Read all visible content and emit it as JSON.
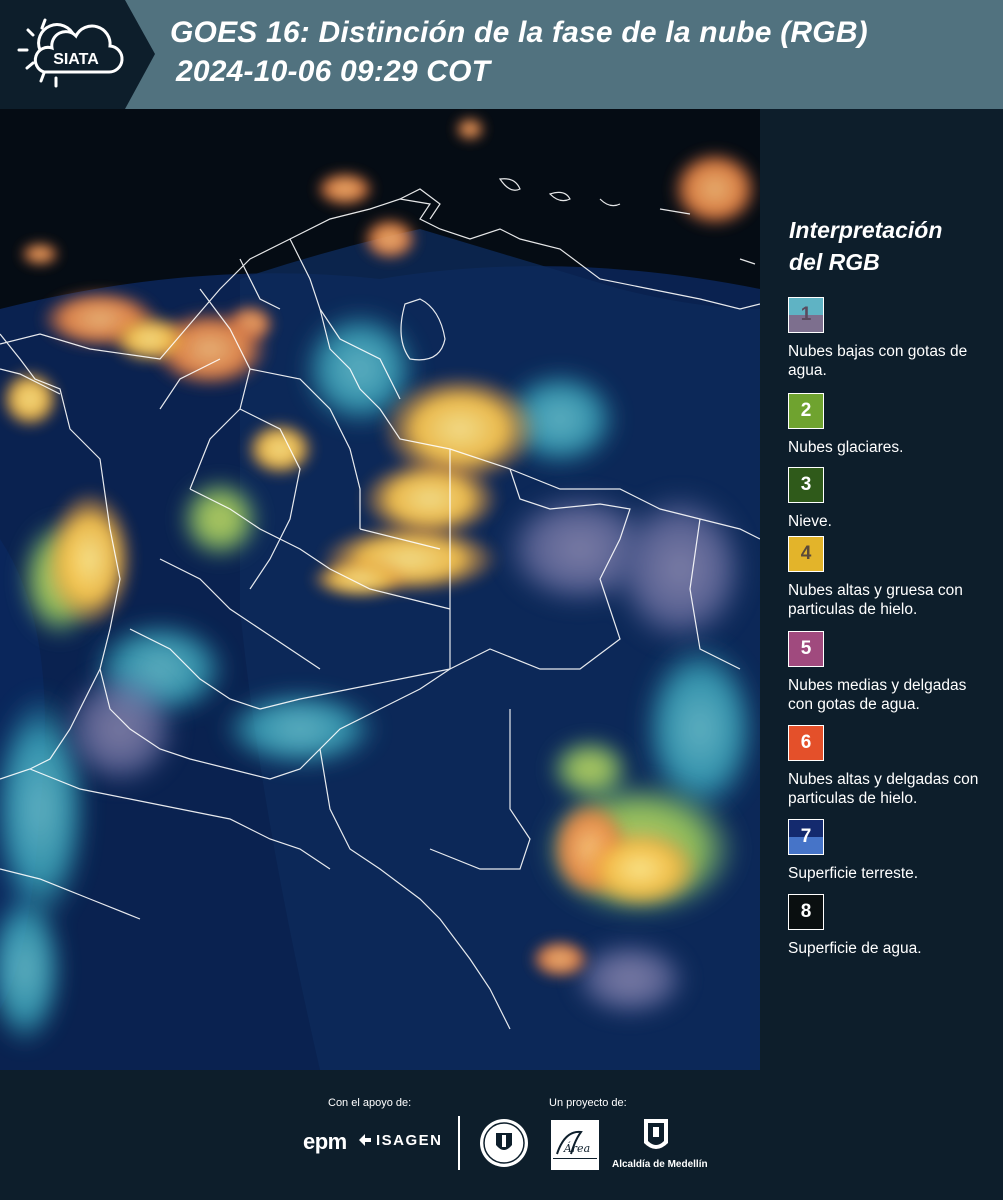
{
  "header": {
    "logo_text": "SIATA",
    "title_line1": "GOES 16: Distinción de la fase de la nube (RGB)",
    "title_line2": "2024-10-06 09:29 COT"
  },
  "map": {
    "icon": "satellite-rgb-image"
  },
  "legend": {
    "title_line1": "Interpretación",
    "title_line2": "del RGB",
    "items": [
      {
        "number": "1",
        "description": "Nubes bajas con gotas de agua.",
        "color_top": "#5fb3c4",
        "color_bottom": "#7d6f8e"
      },
      {
        "number": "2",
        "description": "Nubes glaciares.",
        "color_top": "#6fa32f",
        "color_bottom": "#6fa32f"
      },
      {
        "number": "3",
        "description": "Nieve.",
        "color_top": "#2f5a1a",
        "color_bottom": "#2f5a1a"
      },
      {
        "number": "4",
        "description": "Nubes altas y gruesa con particulas de hielo.",
        "color_top": "#e3b42a",
        "color_bottom": "#e3b42a"
      },
      {
        "number": "5",
        "description": "Nubes medias y delgadas con gotas de agua.",
        "color_top": "#a04a7e",
        "color_bottom": "#a04a7e"
      },
      {
        "number": "6",
        "description": "Nubes altas y delgadas con particulas de hielo.",
        "color_top": "#e4502a",
        "color_bottom": "#e4502a"
      },
      {
        "number": "7",
        "description": "Superficie terreste.",
        "color_top": "#142a6e",
        "color_bottom": "#4674c8"
      },
      {
        "number": "8",
        "description": "Superficie de agua.",
        "color_top": "#0a0f10",
        "color_bottom": "#0a0f10"
      }
    ]
  },
  "footer": {
    "support_label": "Con el apoyo de:",
    "project_label": "Un proyecto de:",
    "epm_logo": "epm",
    "isagen_logo": "ISAGEN",
    "amva_logo": "Área METROPOLITANA Valle de Aburrá",
    "alcaldia_label": "Alcaldía de Medellín"
  },
  "colors": {
    "header_bg": "#51727f",
    "panel_bg": "#0d1e2b",
    "map_bg": "#08163a"
  }
}
